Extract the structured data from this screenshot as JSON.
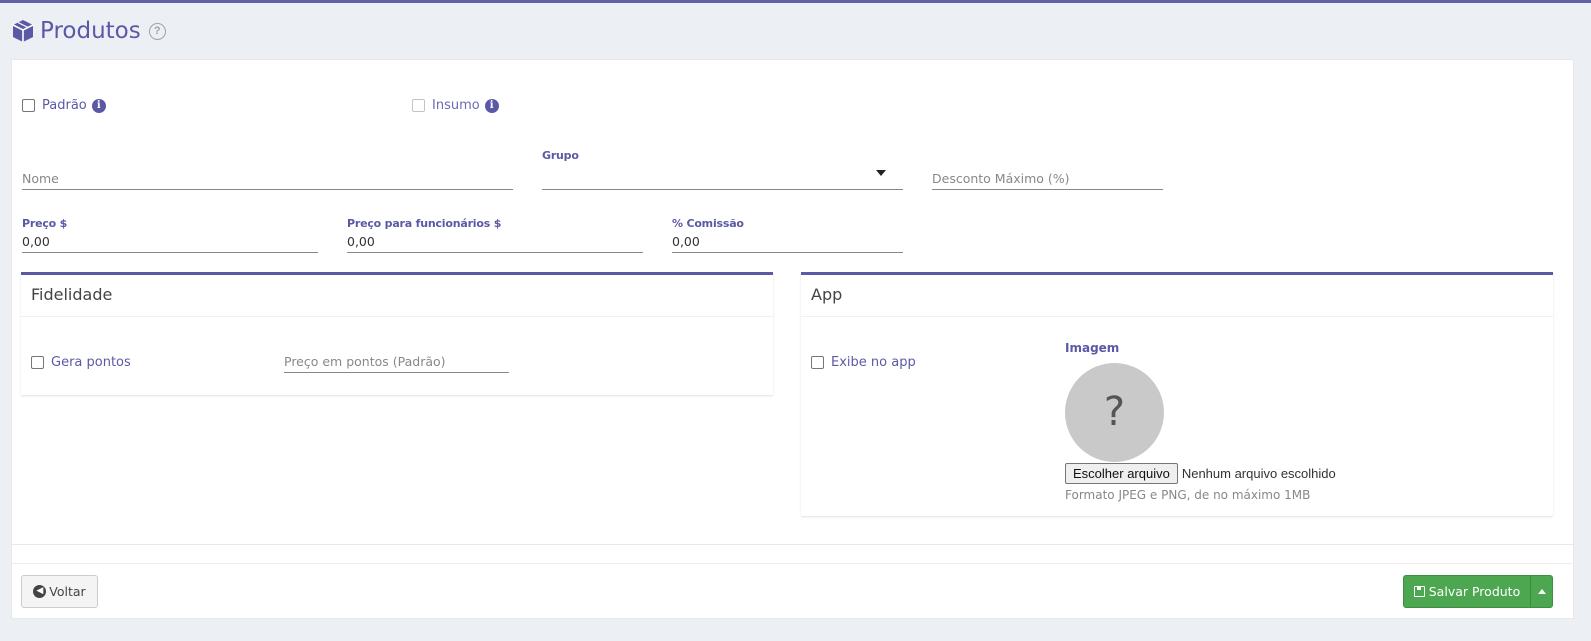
{
  "header": {
    "title": "Produtos",
    "help_symbol": "?"
  },
  "flags": {
    "padrao_label": "Padrão",
    "insumo_label": "Insumo",
    "info_symbol": "i"
  },
  "form": {
    "nome_placeholder": "Nome",
    "grupo_label": "Grupo",
    "grupo_value": "",
    "desconto_placeholder": "Desconto Máximo (%)",
    "preco_label": "Preço $",
    "preco_value": "0,00",
    "preco_func_label": "Preço para funcionários $",
    "preco_func_value": "0,00",
    "comissao_label": "% Comissão",
    "comissao_value": "0,00"
  },
  "fidelidade": {
    "title": "Fidelidade",
    "gera_pontos_label": "Gera pontos",
    "preco_pontos_placeholder": "Preço em pontos (Padrão)"
  },
  "app": {
    "title": "App",
    "exibe_label": "Exibe no app",
    "imagem_label": "Imagem",
    "image_placeholder_symbol": "?",
    "file_button": "Escolher arquivo",
    "file_status": "Nenhum arquivo escolhido",
    "format_hint": "Formato JPEG e PNG, de no máximo 1MB"
  },
  "actions": {
    "back_label": "Voltar",
    "save_label": "Salvar Produto"
  },
  "colors": {
    "accent": "#5b59a6",
    "success": "#4ca750",
    "background": "#eceff4"
  }
}
